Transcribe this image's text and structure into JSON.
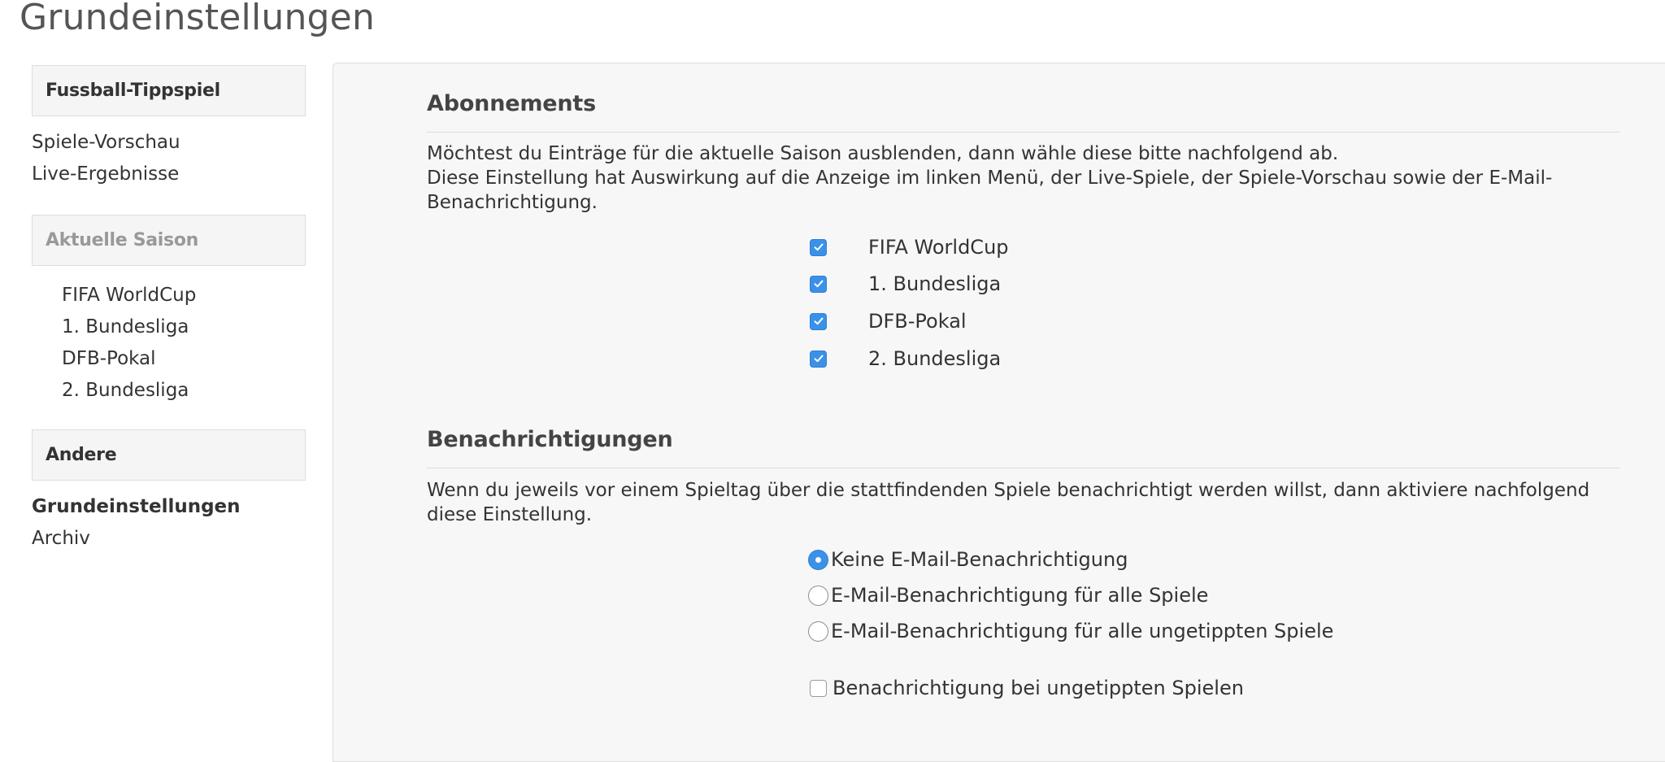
{
  "page": {
    "title": "Grundeinstellungen"
  },
  "sidebar": {
    "groups": [
      {
        "header": "Fussball-Tippspiel",
        "items": [
          "Spiele-Vorschau",
          "Live-Ergebnisse"
        ]
      },
      {
        "header": "Aktuelle Saison",
        "items": [
          "FIFA WorldCup",
          "1. Bundesliga",
          "DFB-Pokal",
          "2. Bundesliga"
        ]
      },
      {
        "header": "Andere",
        "items": [
          "Grundeinstellungen",
          "Archiv"
        ],
        "active_item": "Grundeinstellungen"
      }
    ]
  },
  "subscriptions": {
    "title": "Abonnements",
    "description_line1": "Möchtest du Einträge für die aktuelle Saison ausblenden, dann wähle diese bitte nachfolgend ab.",
    "description_line2": "Diese Einstellung hat Auswirkung auf die Anzeige im linken Menü, der Live-Spiele, der Spiele-Vorschau sowie der E-Mail-Benachrichtigung.",
    "items": [
      {
        "label": "FIFA WorldCup",
        "checked": true
      },
      {
        "label": "1. Bundesliga",
        "checked": true
      },
      {
        "label": "DFB-Pokal",
        "checked": true
      },
      {
        "label": "2. Bundesliga",
        "checked": true
      }
    ]
  },
  "notifications": {
    "title": "Benachrichtigungen",
    "description": "Wenn du jeweils vor einem Spieltag über die stattfindenden Spiele benachrichtigt werden willst, dann aktiviere nachfolgend diese Einstellung.",
    "options": [
      {
        "label": "Keine E-Mail-Benachrichtigung",
        "selected": true
      },
      {
        "label": "E-Mail-Benachrichtigung für alle Spiele",
        "selected": false
      },
      {
        "label": "E-Mail-Benachrichtigung für alle ungetippten Spiele",
        "selected": false
      }
    ],
    "untipped_checkbox": {
      "label": "Benachrichtigung bei ungetippten Spielen",
      "checked": false
    }
  },
  "colors": {
    "accent": "#3b91e8",
    "panel_bg": "#f7f7f7",
    "sidebar_header_bg": "#f5f5f5",
    "border": "#dddddd"
  }
}
